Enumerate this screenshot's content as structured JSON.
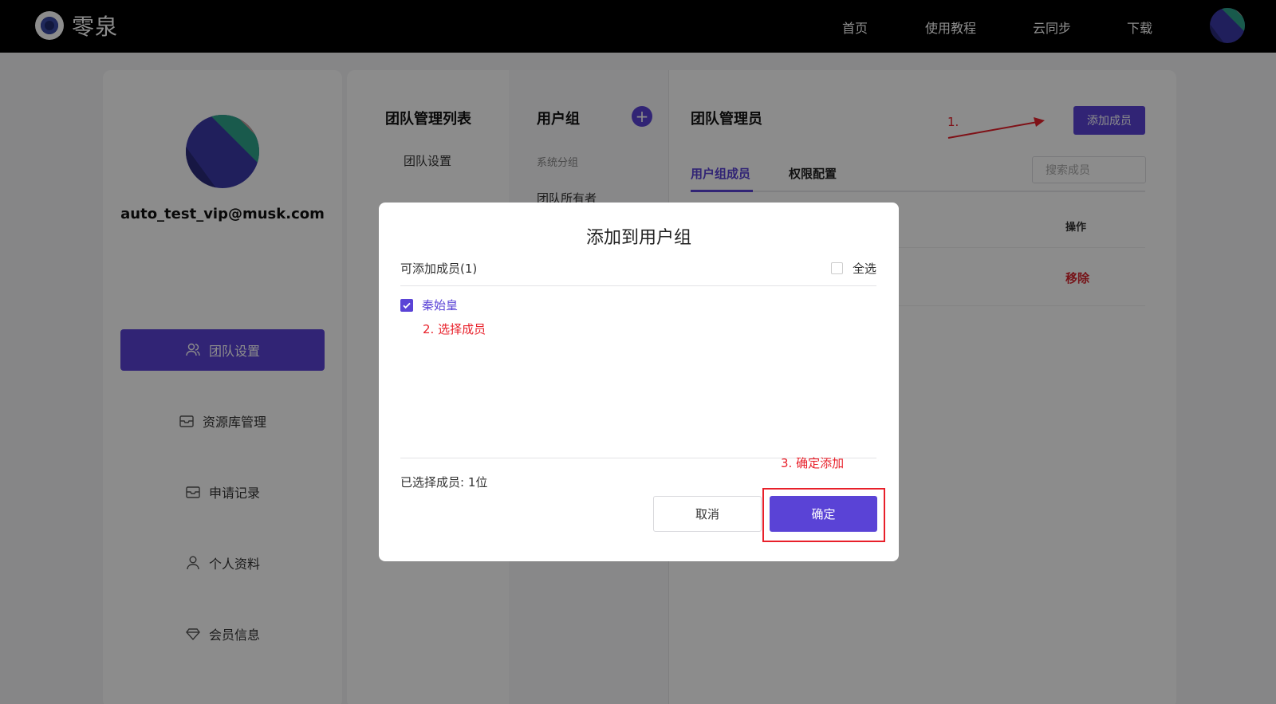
{
  "header": {
    "logo_text": "零泉",
    "nav": [
      "首页",
      "使用教程",
      "云同步",
      "下载"
    ]
  },
  "profile": {
    "email": "auto_test_vip@musk.com"
  },
  "sidebar": {
    "items": [
      {
        "label": "团队设置",
        "icon": "users-icon",
        "active": true
      },
      {
        "label": "资源库管理",
        "icon": "library-icon"
      },
      {
        "label": "申请记录",
        "icon": "inbox-icon"
      },
      {
        "label": "个人资料",
        "icon": "user-icon"
      },
      {
        "label": "会员信息",
        "icon": "diamond-icon"
      }
    ]
  },
  "team": {
    "list_title": "团队管理列表",
    "settings_item": "团队设置",
    "usergroup_title": "用户组",
    "system_group_label": "系统分组",
    "owner_group_partial": "团队所有者",
    "admin_title": "团队管理员",
    "add_member_button": "添加成员",
    "tabs": [
      "用户组成员",
      "权限配置"
    ],
    "search_placeholder": "搜索成员",
    "col_action": "操作",
    "remove_label": "移除"
  },
  "annotations": {
    "step1": "1.",
    "step2": "2. 选择成员",
    "step3": "3. 确定添加"
  },
  "modal": {
    "title": "添加到用户组",
    "available_label": "可添加成员(1)",
    "select_all": "全选",
    "members": [
      {
        "name": "秦始皇",
        "checked": true
      }
    ],
    "selected_count": "已选择成员: 1位",
    "cancel": "取消",
    "confirm": "确定"
  },
  "colors": {
    "accent": "#5a43d6",
    "danger": "#e8202a"
  }
}
